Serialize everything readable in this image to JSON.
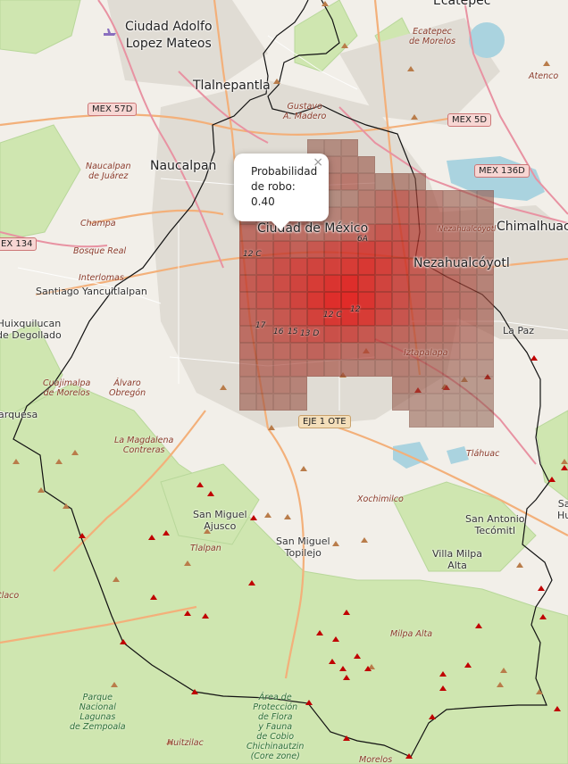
{
  "popup": {
    "title": "Probabilidad de robo:",
    "value": "0.40",
    "close": "×"
  },
  "cities": {
    "ecatepec": "Ecatepec",
    "ciudad_adolfo": "Ciudad Adolfo\nLopez Mateos",
    "tlalnepantla": "Tlalnepantla",
    "naucalpan": "Naucalpan",
    "cdmx": "Ciudad de México",
    "chimalhuacan": "Chimalhuac",
    "nezahualcoyotl": "Nezahualcóyotl"
  },
  "towns": {
    "santiago": "Santiago Yancuitlalpan",
    "huixquilucan": "Huixquilucan\nde Degollado",
    "la_paz": "La Paz",
    "san_miguel_ajusco": "San Miguel\nAjusco",
    "san_miguel_topilejo": "San Miguel\nTopilejo",
    "san_antonio": "San Antonio\nTecómitl",
    "villa_milpa": "Villa Milpa\nAlta",
    "marquesa": "arquesa",
    "sa_hu": "Sa\nHu"
  },
  "italic_labels": {
    "gustavo": "Gustavo\nA. Madero",
    "ecatepec_morelos": "Ecatepec\nde Morelos",
    "atenco": "Atenco",
    "naucalpan_juarez": "Naucalpan\nde Juárez",
    "champa": "Champa",
    "bosque_real": "Bosque Real",
    "interlomas": "Interlomas",
    "cuajimalpa": "Cuajimalpa\nde Morelos",
    "alvaro": "Álvaro\nObregón",
    "magdalena": "La Magdalena\nContreras",
    "iztapalapa": "Iztapalapa",
    "tlahuac": "Tláhuac",
    "xochimilco": "Xochimilco",
    "tlalpan": "Tlalpan",
    "milpa_alta": "Milpa Alta",
    "tlatico": "tlaco",
    "huitzilac": "Huitzilac",
    "morelos": "Morelos",
    "nezahualcoyotl_small": "Nezahualcóyotl"
  },
  "parks": {
    "parque_lagunas": "Parque\nNacional\nLagunas\nde Zempoala",
    "area_proteccion": "Área de\nProtección\nde Flora\ny Fauna\nde Cobio\nChichinautzin\n(Core zone)"
  },
  "shields": {
    "mex57d": "MEX 57D",
    "mex5d": "MEX 5D",
    "mex136d": "MEX 136D",
    "mex134": "EX 134",
    "eje1ote": "EJE 1 OTE"
  },
  "street_labels": [
    "12 C",
    "17",
    "16",
    "15",
    "13 D",
    "12 C",
    "12",
    "6A"
  ],
  "colors": {
    "heat": "#e5402e",
    "boundary": "#111111",
    "forest": "#cfe6b0",
    "water": "#aad3df"
  },
  "heatmap": {
    "metric": "Probabilidad de robo",
    "cells": [
      [
        3,
        0,
        0.3
      ],
      [
        3,
        1,
        0.32
      ],
      [
        3,
        2,
        0.45
      ],
      [
        3,
        3,
        0.4
      ],
      [
        3,
        4,
        0.32
      ],
      [
        3,
        5,
        0.22
      ],
      [
        3,
        6,
        0.25
      ],
      [
        3,
        7,
        0.35
      ],
      [
        3,
        8,
        0.42
      ],
      [
        3,
        9,
        0.5
      ],
      [
        3,
        10,
        0.4
      ],
      [
        3,
        11,
        0.32
      ],
      [
        3,
        12,
        0.25
      ],
      [
        3,
        13,
        0.2
      ],
      [
        3,
        14,
        0.25
      ],
      [
        4,
        0,
        0.36
      ],
      [
        4,
        1,
        0.4
      ],
      [
        4,
        2,
        0.42
      ],
      [
        4,
        3,
        0.4
      ],
      [
        4,
        4,
        0.36
      ],
      [
        4,
        5,
        0.3
      ],
      [
        4,
        6,
        0.35
      ],
      [
        4,
        7,
        0.4
      ],
      [
        4,
        8,
        0.45
      ],
      [
        4,
        9,
        0.55
      ],
      [
        4,
        10,
        0.48
      ],
      [
        4,
        11,
        0.38
      ],
      [
        4,
        12,
        0.32
      ],
      [
        4,
        13,
        0.28
      ],
      [
        4,
        14,
        0.25
      ],
      [
        5,
        0,
        0.45
      ],
      [
        5,
        1,
        0.48
      ],
      [
        5,
        2,
        0.5
      ],
      [
        5,
        3,
        0.45
      ],
      [
        5,
        4,
        0.4
      ],
      [
        5,
        5,
        0.45
      ],
      [
        5,
        6,
        0.5
      ],
      [
        5,
        7,
        0.55
      ],
      [
        5,
        8,
        0.6
      ],
      [
        5,
        9,
        0.62
      ],
      [
        5,
        10,
        0.5
      ],
      [
        5,
        11,
        0.42
      ],
      [
        5,
        12,
        0.38
      ],
      [
        5,
        13,
        0.3
      ],
      [
        5,
        14,
        0.28
      ],
      [
        6,
        0,
        0.5
      ],
      [
        6,
        1,
        0.55
      ],
      [
        6,
        2,
        0.6
      ],
      [
        6,
        3,
        0.55
      ],
      [
        6,
        4,
        0.6
      ],
      [
        6,
        5,
        0.65
      ],
      [
        6,
        6,
        0.7
      ],
      [
        6,
        7,
        0.72
      ],
      [
        6,
        8,
        0.7
      ],
      [
        6,
        9,
        0.65
      ],
      [
        6,
        10,
        0.55
      ],
      [
        6,
        11,
        0.45
      ],
      [
        6,
        12,
        0.4
      ],
      [
        6,
        13,
        0.35
      ],
      [
        6,
        14,
        0.3
      ],
      [
        7,
        0,
        0.55
      ],
      [
        7,
        1,
        0.6
      ],
      [
        7,
        2,
        0.65
      ],
      [
        7,
        3,
        0.7
      ],
      [
        7,
        4,
        0.72
      ],
      [
        7,
        5,
        0.75
      ],
      [
        7,
        6,
        0.78
      ],
      [
        7,
        7,
        0.8
      ],
      [
        7,
        8,
        0.75
      ],
      [
        7,
        9,
        0.68
      ],
      [
        7,
        10,
        0.58
      ],
      [
        7,
        11,
        0.48
      ],
      [
        7,
        12,
        0.42
      ],
      [
        7,
        13,
        0.38
      ],
      [
        7,
        14,
        0.32
      ],
      [
        8,
        0,
        0.58
      ],
      [
        8,
        1,
        0.62
      ],
      [
        8,
        2,
        0.68
      ],
      [
        8,
        3,
        0.72
      ],
      [
        8,
        4,
        0.78
      ],
      [
        8,
        5,
        0.82
      ],
      [
        8,
        6,
        0.85
      ],
      [
        8,
        7,
        0.8
      ],
      [
        8,
        8,
        0.72
      ],
      [
        8,
        9,
        0.65
      ],
      [
        8,
        10,
        0.58
      ],
      [
        8,
        11,
        0.5
      ],
      [
        8,
        12,
        0.45
      ],
      [
        8,
        13,
        0.38
      ],
      [
        8,
        14,
        0.3
      ],
      [
        9,
        0,
        0.55
      ],
      [
        9,
        1,
        0.6
      ],
      [
        9,
        2,
        0.65
      ],
      [
        9,
        3,
        0.72
      ],
      [
        9,
        4,
        0.8
      ],
      [
        9,
        5,
        0.85
      ],
      [
        9,
        6,
        0.88
      ],
      [
        9,
        7,
        0.82
      ],
      [
        9,
        8,
        0.72
      ],
      [
        9,
        9,
        0.65
      ],
      [
        9,
        10,
        0.58
      ],
      [
        9,
        11,
        0.5
      ],
      [
        9,
        12,
        0.45
      ],
      [
        9,
        13,
        0.4
      ],
      [
        9,
        14,
        0.32
      ],
      [
        10,
        0,
        0.5
      ],
      [
        10,
        1,
        0.55
      ],
      [
        10,
        2,
        0.6
      ],
      [
        10,
        3,
        0.68
      ],
      [
        10,
        4,
        0.75
      ],
      [
        10,
        5,
        0.8
      ],
      [
        10,
        6,
        0.82
      ],
      [
        10,
        7,
        0.78
      ],
      [
        10,
        8,
        0.7
      ],
      [
        10,
        9,
        0.62
      ],
      [
        10,
        10,
        0.55
      ],
      [
        10,
        11,
        0.5
      ],
      [
        10,
        12,
        0.42
      ],
      [
        10,
        13,
        0.38
      ],
      [
        10,
        14,
        0.3
      ],
      [
        11,
        0,
        0.45
      ],
      [
        11,
        1,
        0.5
      ],
      [
        11,
        2,
        0.55
      ],
      [
        11,
        3,
        0.6
      ],
      [
        11,
        4,
        0.62
      ],
      [
        11,
        5,
        0.65
      ],
      [
        11,
        6,
        0.65
      ],
      [
        11,
        7,
        0.6
      ],
      [
        11,
        8,
        0.55
      ],
      [
        11,
        9,
        0.5
      ],
      [
        11,
        10,
        0.45
      ],
      [
        11,
        11,
        0.4
      ],
      [
        11,
        12,
        0.38
      ],
      [
        11,
        13,
        0.32
      ],
      [
        11,
        14,
        0.28
      ],
      [
        12,
        0,
        0.42
      ],
      [
        12,
        1,
        0.45
      ],
      [
        12,
        2,
        0.48
      ],
      [
        12,
        3,
        0.5
      ],
      [
        12,
        4,
        0.52
      ],
      [
        12,
        5,
        0.5
      ],
      [
        12,
        6,
        0.45
      ],
      [
        12,
        7,
        0.45
      ],
      [
        12,
        8,
        0.42
      ],
      [
        12,
        9,
        0.4
      ],
      [
        12,
        10,
        0.38
      ],
      [
        12,
        11,
        0.35
      ],
      [
        12,
        12,
        0.32
      ],
      [
        12,
        13,
        0.28
      ],
      [
        12,
        14,
        0.25
      ],
      [
        13,
        0,
        0.35
      ],
      [
        13,
        1,
        0.38
      ],
      [
        13,
        2,
        0.4
      ],
      [
        13,
        3,
        0.4
      ],
      [
        13,
        4,
        0.38
      ],
      [
        13,
        5,
        0.35
      ],
      [
        13,
        6,
        0.32
      ],
      [
        13,
        7,
        0.3
      ],
      [
        13,
        8,
        0.3
      ],
      [
        13,
        9,
        0.32
      ],
      [
        13,
        10,
        0.3
      ],
      [
        13,
        11,
        0.28
      ],
      [
        13,
        12,
        0.25
      ],
      [
        13,
        13,
        0.22
      ],
      [
        13,
        14,
        0.2
      ],
      [
        14,
        0,
        0.3
      ],
      [
        14,
        1,
        0.32
      ],
      [
        14,
        2,
        0.33
      ],
      [
        14,
        3,
        0.3
      ],
      [
        14,
        9,
        0.28
      ],
      [
        14,
        10,
        0.25
      ],
      [
        14,
        11,
        0.22
      ],
      [
        14,
        12,
        0.2
      ],
      [
        14,
        13,
        0.18
      ],
      [
        14,
        14,
        0.18
      ],
      [
        15,
        0,
        0.25
      ],
      [
        15,
        1,
        0.28
      ],
      [
        15,
        2,
        0.28
      ],
      [
        15,
        3,
        0.25
      ],
      [
        15,
        9,
        0.2
      ],
      [
        15,
        10,
        0.2
      ],
      [
        15,
        11,
        0.18
      ],
      [
        15,
        12,
        0.18
      ],
      [
        15,
        13,
        0.16
      ],
      [
        15,
        14,
        0.15
      ],
      [
        16,
        10,
        0.18
      ],
      [
        16,
        11,
        0.16
      ],
      [
        16,
        12,
        0.15
      ],
      [
        16,
        13,
        0.15
      ],
      [
        16,
        14,
        0.14
      ],
      [
        0,
        4,
        0.2
      ],
      [
        0,
        5,
        0.22
      ],
      [
        0,
        6,
        0.25
      ],
      [
        1,
        4,
        0.28
      ],
      [
        1,
        5,
        0.3
      ],
      [
        1,
        6,
        0.28
      ],
      [
        1,
        7,
        0.25
      ],
      [
        2,
        4,
        0.32
      ],
      [
        2,
        5,
        0.35
      ],
      [
        2,
        6,
        0.38
      ],
      [
        2,
        7,
        0.3
      ],
      [
        2,
        8,
        0.22
      ],
      [
        2,
        9,
        0.25
      ],
      [
        2,
        10,
        0.2
      ]
    ]
  }
}
